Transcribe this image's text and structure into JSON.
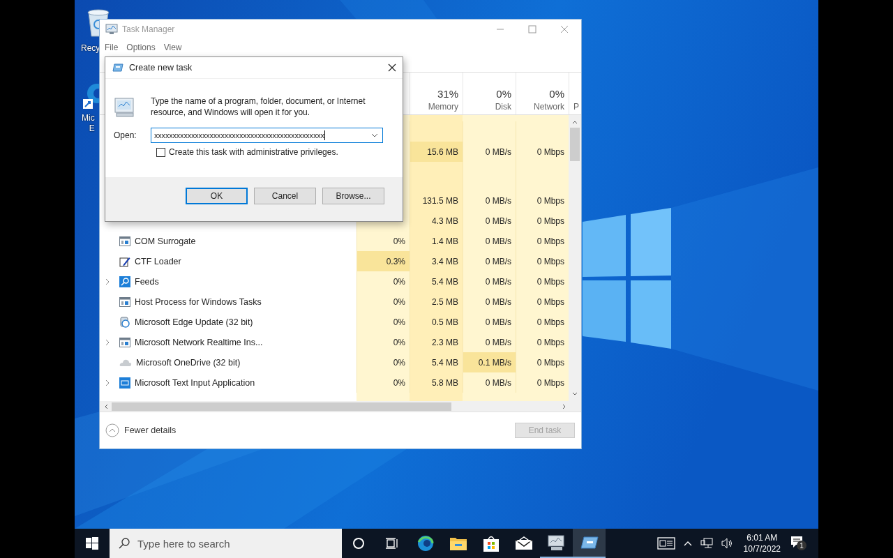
{
  "desktop_icons": [
    {
      "kind": "recycle-bin",
      "label": [
        "Recy"
      ]
    },
    {
      "kind": "edge",
      "label": [
        "Mic",
        "E"
      ]
    }
  ],
  "task_manager": {
    "title": "Task Manager",
    "menu": [
      "File",
      "Options",
      "View"
    ],
    "headers": [
      {
        "percent": "31%",
        "label": "Memory"
      },
      {
        "percent": "0%",
        "label": "Disk"
      },
      {
        "percent": "0%",
        "label": "Network"
      },
      {
        "label": "P"
      }
    ],
    "rows": [
      {
        "kind": "blank"
      },
      {
        "kind": "hidden",
        "memory": {
          "value": "15.6 MB",
          "hot": true
        },
        "disk": {
          "value": "0 MB/s",
          "hot": false
        },
        "network": {
          "value": "0 Mbps",
          "hot": false
        }
      },
      {
        "kind": "group"
      },
      {
        "kind": "hidden",
        "memory": {
          "value": "131.5 MB",
          "hot": false
        },
        "disk": {
          "value": "0 MB/s",
          "hot": false
        },
        "network": {
          "value": "0 Mbps",
          "hot": false
        }
      },
      {
        "kind": "hidden",
        "memory": {
          "value": "4.3 MB",
          "hot": false
        },
        "disk": {
          "value": "0 MB/s",
          "hot": false
        },
        "network": {
          "value": "0 Mbps",
          "hot": false
        }
      },
      {
        "kind": "window",
        "name": "COM Surrogate",
        "expandable": false,
        "cpu": {
          "value": "0%",
          "hot": false
        },
        "memory": {
          "value": "1.4 MB",
          "hot": false
        },
        "disk": {
          "value": "0 MB/s",
          "hot": false
        },
        "network": {
          "value": "0 Mbps",
          "hot": false
        }
      },
      {
        "kind": "pen",
        "name": "CTF Loader",
        "expandable": false,
        "cpu": {
          "value": "0.3%",
          "hot": true
        },
        "memory": {
          "value": "3.4 MB",
          "hot": false
        },
        "disk": {
          "value": "0 MB/s",
          "hot": false
        },
        "network": {
          "value": "0 Mbps",
          "hot": false
        }
      },
      {
        "kind": "search",
        "name": "Feeds",
        "expandable": true,
        "cpu": {
          "value": "0%",
          "hot": false
        },
        "memory": {
          "value": "5.4 MB",
          "hot": false
        },
        "disk": {
          "value": "0 MB/s",
          "hot": false
        },
        "network": {
          "value": "0 Mbps",
          "hot": false
        }
      },
      {
        "kind": "window",
        "name": "Host Process for Windows Tasks",
        "expandable": false,
        "cpu": {
          "value": "0%",
          "hot": false
        },
        "memory": {
          "value": "2.5 MB",
          "hot": false
        },
        "disk": {
          "value": "0 MB/s",
          "hot": false
        },
        "network": {
          "value": "0 Mbps",
          "hot": false
        }
      },
      {
        "kind": "updater",
        "name": "Microsoft Edge Update (32 bit)",
        "expandable": false,
        "cpu": {
          "value": "0%",
          "hot": false
        },
        "memory": {
          "value": "0.5 MB",
          "hot": false
        },
        "disk": {
          "value": "0 MB/s",
          "hot": false
        },
        "network": {
          "value": "0 Mbps",
          "hot": false
        }
      },
      {
        "kind": "window",
        "name": "Microsoft Network Realtime Ins...",
        "expandable": true,
        "cpu": {
          "value": "0%",
          "hot": false
        },
        "memory": {
          "value": "2.3 MB",
          "hot": false
        },
        "disk": {
          "value": "0 MB/s",
          "hot": false
        },
        "network": {
          "value": "0 Mbps",
          "hot": false
        }
      },
      {
        "kind": "cloud",
        "name": "Microsoft OneDrive (32 bit)",
        "expandable": false,
        "cpu": {
          "value": "0%",
          "hot": false
        },
        "memory": {
          "value": "5.4 MB",
          "hot": false
        },
        "disk": {
          "value": "0.1 MB/s",
          "hot": true
        },
        "network": {
          "value": "0 Mbps",
          "hot": false
        }
      },
      {
        "kind": "keyboard",
        "name": "Microsoft Text Input Application",
        "expandable": true,
        "cpu": {
          "value": "0%",
          "hot": false
        },
        "memory": {
          "value": "5.8 MB",
          "hot": false
        },
        "disk": {
          "value": "0 MB/s",
          "hot": false
        },
        "network": {
          "value": "0 Mbps",
          "hot": false
        }
      }
    ],
    "fewer_details": "Fewer details",
    "end_task": {
      "label": "End task",
      "disabled": true
    }
  },
  "dialog": {
    "title": "Create new task",
    "message": "Type the name of a program, folder, document, or Internet resource, and Windows will open it for you.",
    "open_label": "Open:",
    "open_value": "xxxxxxxxxxxxxxxxxxxxxxxxxxxxxxxxxxxxxxxxxxxxxx",
    "admin": {
      "label": "Create this task with administrative privileges.",
      "checked": false
    },
    "buttons": [
      "OK",
      "Cancel",
      "Browse..."
    ]
  },
  "taskbar": {
    "search_placeholder": "Type here to search",
    "apps": [
      {
        "kind": "edge",
        "running": false,
        "selected": false
      },
      {
        "kind": "folder",
        "running": false,
        "selected": false
      },
      {
        "kind": "store",
        "running": false,
        "selected": false
      },
      {
        "kind": "mail",
        "running": false,
        "selected": false
      },
      {
        "kind": "monitor",
        "running": true,
        "selected": false
      },
      {
        "kind": "run",
        "running": true,
        "selected": true
      }
    ],
    "time": "6:01 AM",
    "date": "10/7/2022",
    "notifications": "1"
  }
}
